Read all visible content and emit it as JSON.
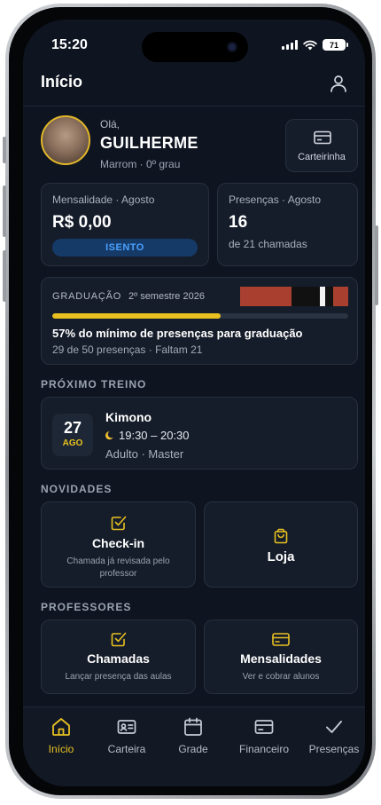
{
  "status_bar": {
    "time": "15:20",
    "battery": "71"
  },
  "header": {
    "title": "Início"
  },
  "greeting": {
    "hello": "Olá,",
    "name": "GUILHERME",
    "belt": "Marrom · 0º grau",
    "card_button": "Carteirinha"
  },
  "mensalidade": {
    "label": "Mensalidade · Agosto",
    "value": "R$ 0,00",
    "badge": "ISENTO"
  },
  "presencas": {
    "label": "Presenças · Agosto",
    "value": "16",
    "sub": "de 21 chamadas"
  },
  "graduacao": {
    "label": "GRADUAÇÃO",
    "semester": "2º semestre 2026",
    "progress_percent": 57,
    "headline": "57% do mínimo de presenças para graduação",
    "detail": "29 de 50 presenças · Faltam 21",
    "colors": {
      "belt_red": "#a9402f",
      "progress": "#e8c121"
    }
  },
  "proximo_treino": {
    "section": "PRÓXIMO TREINO",
    "day": "27",
    "month": "AGO",
    "name": "Kimono",
    "time_icon": "moon-icon",
    "time": "19:30 – 20:30",
    "class": "Adulto · Master"
  },
  "novidades": {
    "section": "NOVIDADES",
    "checkin": {
      "icon": "check-square-icon",
      "title": "Check-in",
      "sub": "Chamada já revisada pelo professor"
    },
    "loja": {
      "icon": "shopping-bag-icon",
      "title": "Loja"
    }
  },
  "professores": {
    "section": "PROFESSORES",
    "chamadas": {
      "icon": "check-square-icon",
      "title": "Chamadas",
      "sub": "Lançar presença das aulas"
    },
    "mensalidades": {
      "icon": "credit-card-icon",
      "title": "Mensalidades",
      "sub": "Ver e cobrar alunos"
    }
  },
  "tabbar": [
    {
      "label": "Início",
      "icon": "home-icon",
      "active": true
    },
    {
      "label": "Carteira",
      "icon": "id-card-icon",
      "active": false
    },
    {
      "label": "Grade",
      "icon": "calendar-icon",
      "active": false
    },
    {
      "label": "Financeiro",
      "icon": "credit-card-icon",
      "active": false
    },
    {
      "label": "Presenças",
      "icon": "checkmark-icon",
      "active": false
    }
  ],
  "accent_color": "#e8c121"
}
